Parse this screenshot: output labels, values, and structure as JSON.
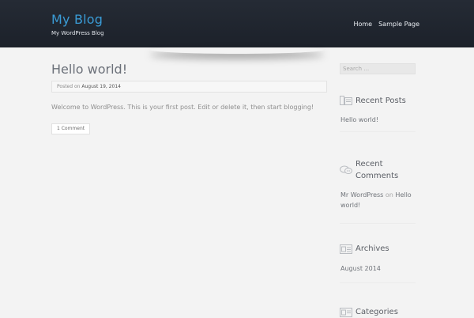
{
  "site": {
    "title": "My Blog",
    "description": "My WordPress Blog"
  },
  "nav": {
    "items": [
      "Home",
      "Sample Page"
    ]
  },
  "post": {
    "title": "Hello world!",
    "posted_on_label": "Posted on",
    "date": "August 19, 2014",
    "content": "Welcome to WordPress. This is your first post. Edit or delete it, then start blogging!",
    "comments_button": "1 Comment"
  },
  "sidebar": {
    "search_placeholder": "Search …",
    "recent_posts": {
      "title": "Recent Posts",
      "items": [
        "Hello world!"
      ]
    },
    "recent_comments": {
      "title_line1": "Recent",
      "title_line2": "Comments",
      "author": "Mr WordPress",
      "on": "on",
      "post_link": "Hello world!"
    },
    "archives": {
      "title": "Archives",
      "items": [
        "August 2014"
      ]
    },
    "categories": {
      "title": "Categories"
    }
  },
  "colors": {
    "header_bg": "#1f242d",
    "accent": "#3a9bd5",
    "page_bg": "#f3f3f3"
  }
}
